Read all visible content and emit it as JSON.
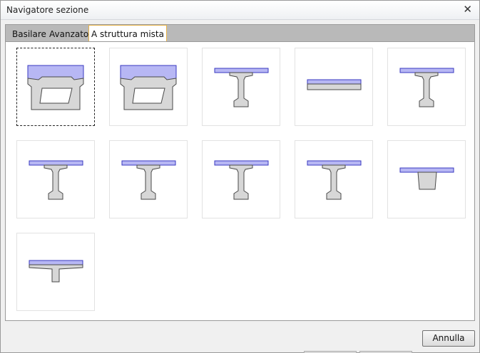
{
  "window": {
    "title": "Navigatore sezione"
  },
  "tabs": [
    {
      "label": "Basilare",
      "active": false
    },
    {
      "label": "Avanzato",
      "active": false
    },
    {
      "label": "A struttura mista",
      "active": true
    }
  ],
  "sections": [
    {
      "name": "box-girder-section-1",
      "icon": "box-girder-icon",
      "selected": true
    },
    {
      "name": "box-girder-section-2",
      "icon": "box-girder-icon",
      "selected": false
    },
    {
      "name": "i-beam-section-1",
      "icon": "i-beam-slab-icon",
      "selected": false
    },
    {
      "name": "flat-slab-section",
      "icon": "flat-slab-icon",
      "selected": false
    },
    {
      "name": "i-beam-section-2",
      "icon": "i-beam-slab-icon",
      "selected": false
    },
    {
      "name": "i-beam-section-3",
      "icon": "i-beam-slab-icon",
      "selected": false
    },
    {
      "name": "i-beam-section-4",
      "icon": "i-beam-slab-icon",
      "selected": false
    },
    {
      "name": "i-beam-section-5",
      "icon": "i-beam-slab-icon",
      "selected": false
    },
    {
      "name": "i-beam-section-6",
      "icon": "i-beam-slab-icon",
      "selected": false
    },
    {
      "name": "tapered-beam-section",
      "icon": "tapered-beam-icon",
      "selected": false
    },
    {
      "name": "t-beam-section",
      "icon": "t-beam-icon",
      "selected": false
    }
  ],
  "footer": {
    "cancel_label": "Annulla"
  },
  "colors": {
    "slab": "#b7b7f4",
    "slab_stroke": "#3a3ac0",
    "beam": "#d7d7d7",
    "beam_stroke": "#4a4a4a",
    "tab_highlight": "#e8b44a"
  }
}
